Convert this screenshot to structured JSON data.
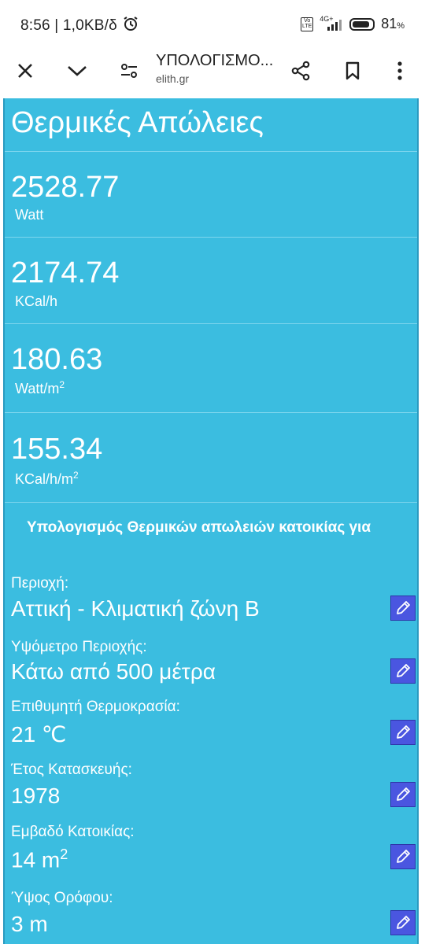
{
  "status": {
    "time_speed": "8:56 | 1,0KB/δ",
    "network": "4G+",
    "battery": "81"
  },
  "toolbar": {
    "title": "ΥΠΟΛΟΓΙΣΜΟ...",
    "url": "elith.gr"
  },
  "main": {
    "heading": "Θερμικές Απώλειες",
    "results": [
      {
        "value": "2528.77",
        "unit": "Watt"
      },
      {
        "value": "2174.74",
        "unit": "KCal/h"
      },
      {
        "value": "180.63",
        "unit": "Watt/m",
        "unit_sup": "2"
      },
      {
        "value": "155.34",
        "unit": "KCal/h/m",
        "unit_sup": "2"
      }
    ],
    "subheading": "Υπολογισμός Θερμικών απωλειών κατοικίας για",
    "fields": [
      {
        "label": "Περιοχή:",
        "value": "Αττική - Κλιματική ζώνη Β"
      },
      {
        "label": "Υψόμετρο Περιοχής:",
        "value": "Κάτω από 500 μέτρα"
      },
      {
        "label": "Επιθυμητή Θερμοκρασία:",
        "value": "21 ℃"
      },
      {
        "label": "Έτος Κατασκευής:",
        "value": "1978"
      },
      {
        "label": "Εμβαδό Κατοικίας:",
        "value": "14 m",
        "value_sup": "2"
      },
      {
        "label": "Ύψος Ορόφου:",
        "value": "3 m"
      }
    ]
  }
}
